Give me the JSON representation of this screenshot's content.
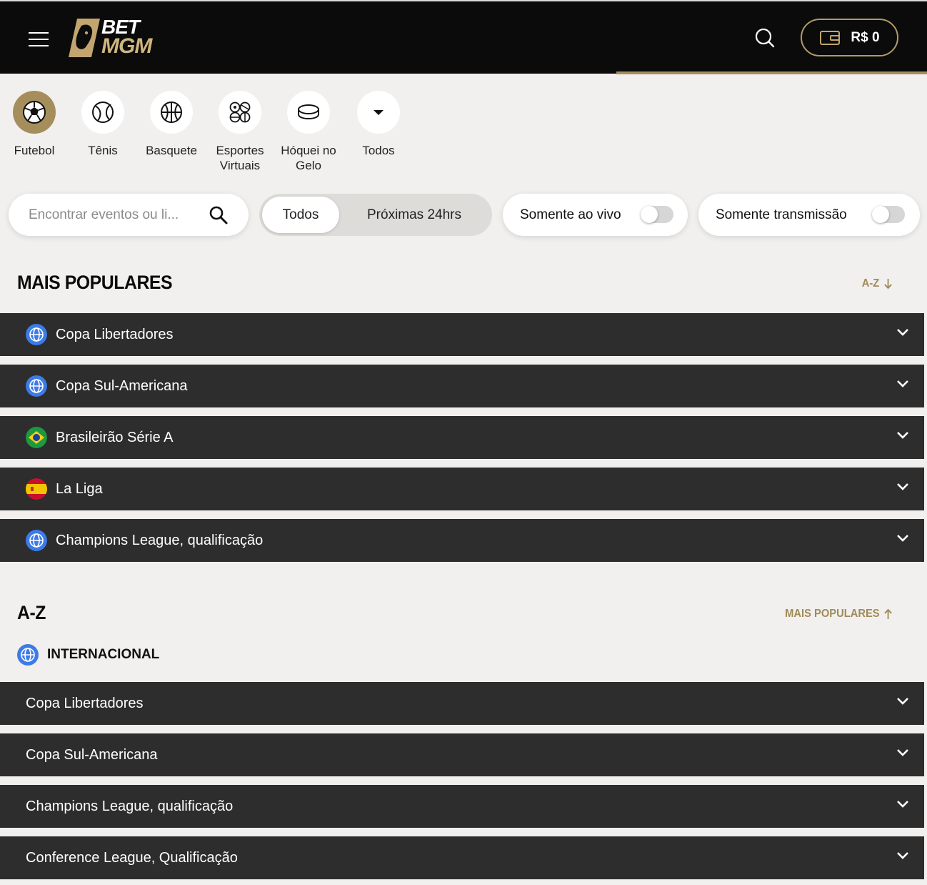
{
  "header": {
    "logo_top": "BET",
    "logo_bottom": "MGM",
    "balance": "R$ 0",
    "accent_color": "#a68e5c"
  },
  "sports": [
    {
      "label": "Futebol",
      "icon": "soccer-ball-icon",
      "active": true
    },
    {
      "label": "Tênis",
      "icon": "tennis-ball-icon",
      "active": false
    },
    {
      "label": "Basquete",
      "icon": "basketball-icon",
      "active": false
    },
    {
      "label": "Esportes Virtuais",
      "icon": "virtual-sports-icon",
      "active": false
    },
    {
      "label": "Hóquei no Gelo",
      "icon": "hockey-puck-icon",
      "active": false
    },
    {
      "label": "Todos",
      "icon": "caret-down-icon",
      "active": false
    }
  ],
  "filters": {
    "search_placeholder": "Encontrar eventos ou li...",
    "period_all": "Todos",
    "period_24h": "Próximas 24hrs",
    "live_only": "Somente ao vivo",
    "stream_only": "Somente transmissão"
  },
  "popular": {
    "title": "MAIS POPULARES",
    "sort_link": "A-Z",
    "items": [
      {
        "name": "Copa Libertadores",
        "flag": "globe-icon"
      },
      {
        "name": "Copa Sul-Americana",
        "flag": "globe-icon"
      },
      {
        "name": "Brasileirão Série A",
        "flag": "brazil-flag-icon"
      },
      {
        "name": "La Liga",
        "flag": "spain-flag-icon"
      },
      {
        "name": "Champions League, qualificação",
        "flag": "globe-icon"
      }
    ]
  },
  "az": {
    "title": "A-Z",
    "sort_link": "MAIS POPULARES",
    "region": "INTERNACIONAL",
    "items": [
      {
        "name": "Copa Libertadores"
      },
      {
        "name": "Copa Sul-Americana"
      },
      {
        "name": "Champions League, qualificação"
      },
      {
        "name": "Conference League, Qualificação"
      }
    ]
  }
}
